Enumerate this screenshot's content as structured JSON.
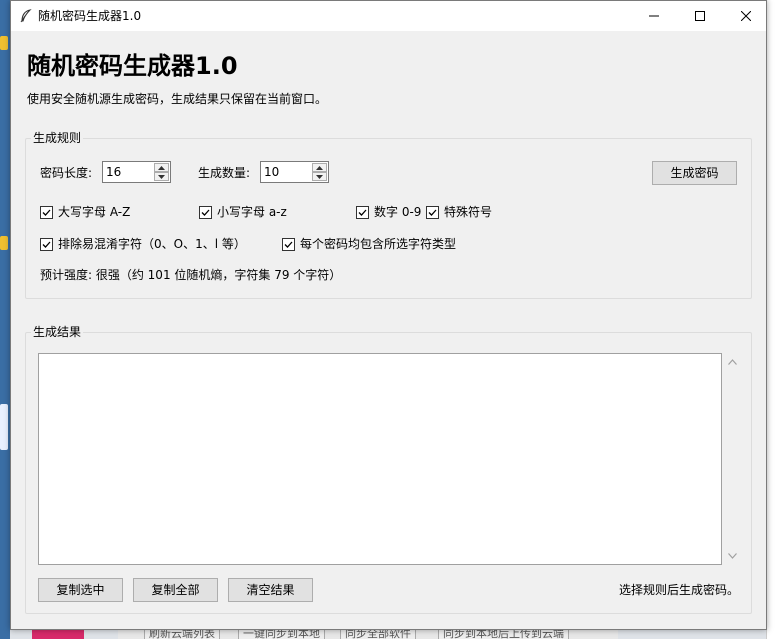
{
  "window": {
    "title": "随机密码生成器1.0"
  },
  "header": {
    "app_title": "随机密码生成器1.0",
    "description": "使用安全随机源生成密码，生成结果只保留在当前窗口。"
  },
  "rules": {
    "group_label": "生成规则",
    "length_label": "密码长度:",
    "length_value": "16",
    "count_label": "生成数量:",
    "count_value": "10",
    "generate_button": "生成密码",
    "options": [
      {
        "label": "大写字母 A-Z",
        "checked": true
      },
      {
        "label": "小写字母 a-z",
        "checked": true
      },
      {
        "label": "数字 0-9",
        "checked": true
      },
      {
        "label": "特殊符号",
        "checked": true
      },
      {
        "label": "排除易混淆字符（0、O、1、l 等）",
        "checked": true
      },
      {
        "label": "每个密码均包含所选字符类型",
        "checked": true
      }
    ],
    "strength_text": "预计强度: 很强（约 101 位随机熵，字符集 79 个字符）"
  },
  "results": {
    "group_label": "生成结果",
    "content": "",
    "copy_selected_button": "复制选中",
    "copy_all_button": "复制全部",
    "clear_button": "清空结果",
    "status_text": "选择规则后生成密码。"
  },
  "background": {
    "bottom_buttons": [
      "刷新云端列表",
      "一键同步到本地",
      "同步全部软件",
      "同步到本地后上传到云端"
    ]
  },
  "colors": {
    "window_bg": "#f0f0f0",
    "button_bg": "#e1e1e1",
    "border": "#adadad"
  }
}
